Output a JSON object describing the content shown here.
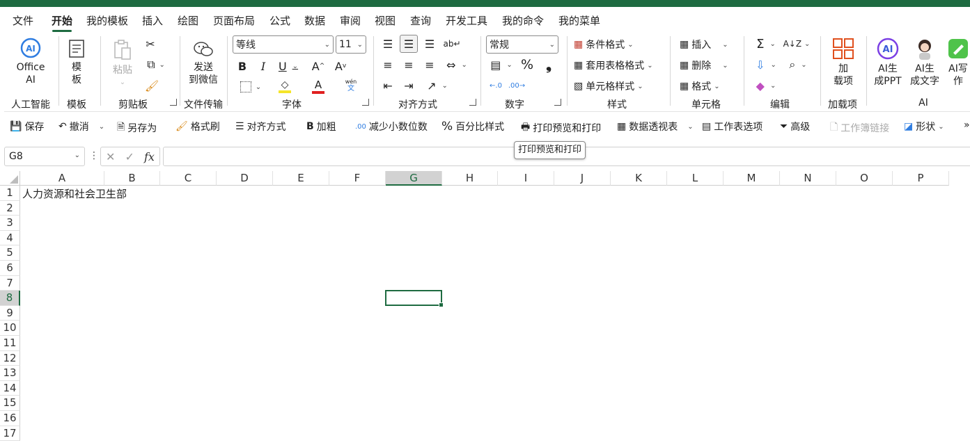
{
  "menu_tabs": [
    "文件",
    "开始",
    "我的模板",
    "插入",
    "绘图",
    "页面布局",
    "公式",
    "数据",
    "审阅",
    "视图",
    "查询",
    "开发工具",
    "我的命令",
    "我的菜单"
  ],
  "active_tab": "开始",
  "ribbon": {
    "ai_group": {
      "button_label": "Office\nAI",
      "group_label": "人工智能"
    },
    "template_group": {
      "button_label": "模\n板",
      "group_label": "模板"
    },
    "clipboard": {
      "paste_label": "粘贴",
      "group_label": "剪贴板"
    },
    "transfer": {
      "button_label": "发送\n到微信",
      "group_label": "文件传输"
    },
    "font": {
      "font_name": "等线",
      "font_size": "11",
      "group_label": "字体",
      "fill_color": "#f5e52a",
      "font_color": "#e02020",
      "wen_label": "wén",
      "wen_char": "文"
    },
    "alignment": {
      "group_label": "对齐方式"
    },
    "number": {
      "format": "常规",
      "group_label": "数字"
    },
    "styles": {
      "conditional": "条件格式",
      "table_format": "套用表格格式",
      "cell_style": "单元格样式",
      "group_label": "样式"
    },
    "cells": {
      "insert": "插入",
      "delete": "删除",
      "format": "格式",
      "group_label": "单元格"
    },
    "editing": {
      "group_label": "编辑"
    },
    "addins": {
      "button_label": "加\n载项",
      "group_label": "加载项"
    },
    "ai": {
      "ppt_label": "AI生\n成PPT",
      "text_label": "AI生\n成文字",
      "write_label": "AI写\n作",
      "group_label": "AI",
      "ai_write_badge": "AI写作"
    }
  },
  "quick_access": [
    {
      "label": "保存",
      "icon": "save-icon"
    },
    {
      "label": "撤消",
      "icon": "undo-icon"
    },
    {
      "label": "另存为",
      "icon": "save-as-icon"
    },
    {
      "label": "格式刷",
      "icon": "format-painter-icon"
    },
    {
      "label": "对齐方式",
      "icon": "align-icon"
    },
    {
      "label": "加粗",
      "icon": "bold-icon"
    },
    {
      "label": "减少小数位数",
      "icon": "decrease-decimal-icon"
    },
    {
      "label": "百分比样式",
      "icon": "percent-icon"
    },
    {
      "label": "打印预览和打印",
      "icon": "print-preview-icon"
    },
    {
      "label": "数据透视表",
      "icon": "pivot-table-icon"
    },
    {
      "label": "工作表选项",
      "icon": "sheet-options-icon"
    },
    {
      "label": "高级",
      "icon": "advanced-filter-icon"
    },
    {
      "label": "工作簿链接",
      "icon": "workbook-links-icon",
      "disabled": true
    },
    {
      "label": "形状",
      "icon": "shapes-icon"
    }
  ],
  "tooltip": "打印预览和打印",
  "formula_bar": {
    "name_box": "G8",
    "fx": "fx",
    "content": ""
  },
  "columns": [
    "A",
    "B",
    "C",
    "D",
    "E",
    "F",
    "G",
    "H",
    "I",
    "J",
    "K",
    "L",
    "M",
    "N",
    "O",
    "P"
  ],
  "rows": [
    "1",
    "2",
    "3",
    "4",
    "5",
    "6",
    "7",
    "8",
    "9",
    "10",
    "11",
    "12",
    "13",
    "14",
    "15",
    "16",
    "17"
  ],
  "selected_cell": {
    "col": "G",
    "row": "8"
  },
  "cells": {
    "A1": "人力资源和社会卫生部"
  },
  "colors": {
    "accent": "#1e6b41",
    "header_selected": "#d2d2d2"
  }
}
